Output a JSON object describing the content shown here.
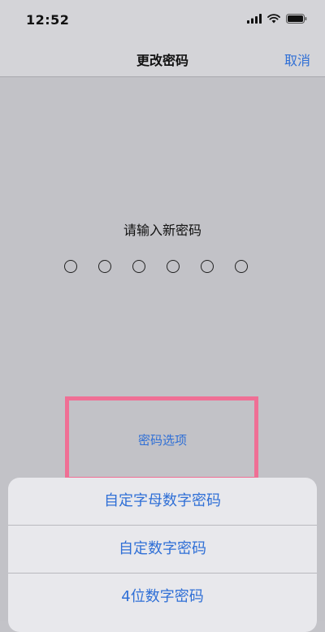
{
  "status_bar": {
    "time": "12:52",
    "icons": [
      "signal-icon",
      "wifi-icon",
      "battery-icon"
    ]
  },
  "nav": {
    "title": "更改密码",
    "cancel_label": "取消"
  },
  "prompt": {
    "text": "请输入新密码",
    "digit_count": 6
  },
  "options": {
    "label": "密码选项"
  },
  "action_sheet": {
    "items": [
      {
        "label": "自定字母数字密码"
      },
      {
        "label": "自定数字密码"
      },
      {
        "label": "4位数字密码"
      }
    ]
  },
  "colors": {
    "accent": "#2f6fd6",
    "highlight": "#ef6f95",
    "background": "#c2c2c7",
    "bar": "#d4d4d8"
  }
}
